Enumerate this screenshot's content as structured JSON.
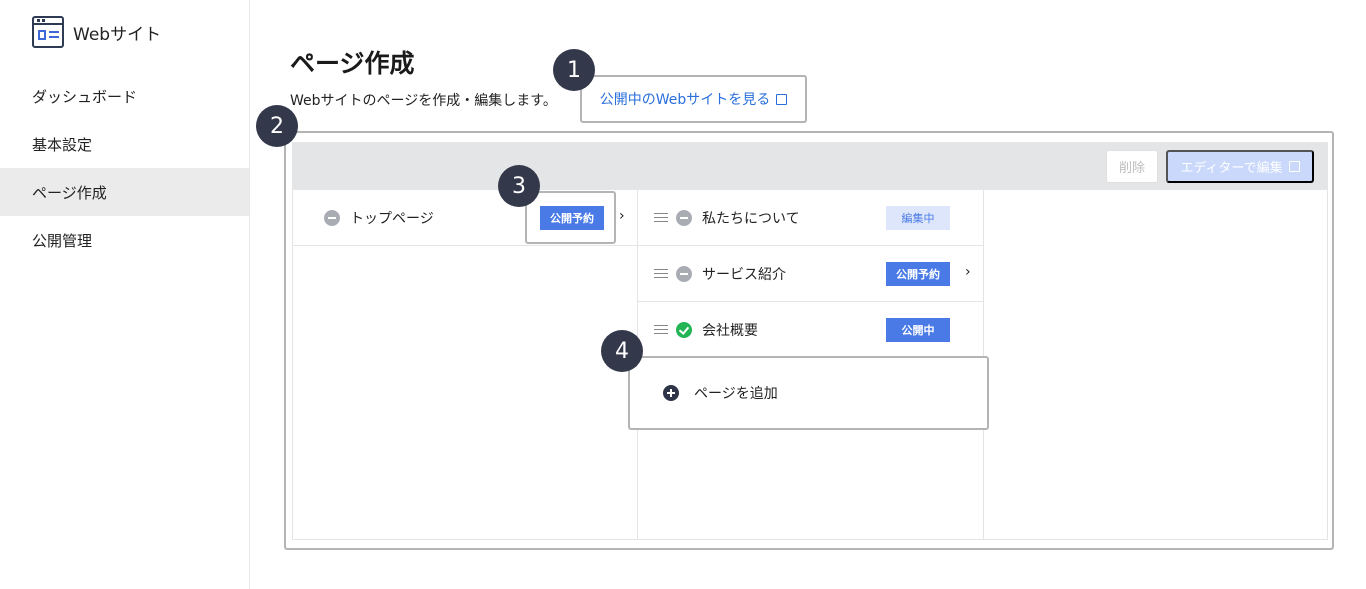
{
  "sidebar": {
    "brand": "Webサイト",
    "brand_icon": "website-layout-icon",
    "items": [
      {
        "label": "ダッシュボード"
      },
      {
        "label": "基本設定"
      },
      {
        "label": "ページ作成",
        "active": true
      },
      {
        "label": "公開管理"
      }
    ]
  },
  "header": {
    "title": "ページ作成",
    "description": "Webサイトのページを作成・編集します。",
    "view_site_label": "公開中のWebサイトを見る"
  },
  "callouts": [
    "1",
    "2",
    "3",
    "4"
  ],
  "toolbar": {
    "delete_label": "削除",
    "editor_label": "エディターで編集"
  },
  "tree": {
    "root": {
      "label": "トップページ",
      "status": "公開予約",
      "status_icon": "minus-circle-icon"
    },
    "children": [
      {
        "label": "私たちについて",
        "status": "編集中",
        "status_icon": "minus-circle-icon"
      },
      {
        "label": "サービス紹介",
        "status": "公開予約",
        "status_icon": "minus-circle-icon"
      },
      {
        "label": "会社概要",
        "status": "公開中",
        "status_icon": "check-circle-icon"
      }
    ],
    "add_label": "ページを追加"
  },
  "colors": {
    "accent": "#4a7ae6",
    "link": "#2a6fdb",
    "published": "#22b455",
    "callout": "#33384a"
  }
}
